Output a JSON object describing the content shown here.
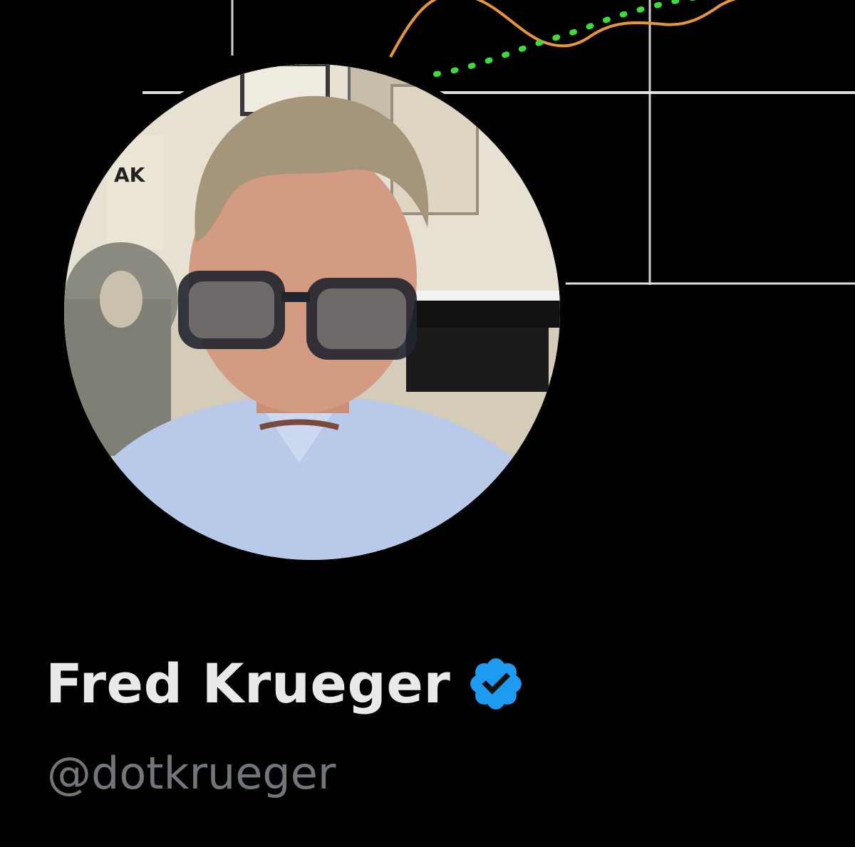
{
  "profile": {
    "display_name": "Fred Krueger",
    "handle": "@dotkrueger",
    "verified": true,
    "verified_icon": "verified-badge-icon"
  },
  "colors": {
    "background": "#000000",
    "name_text": "#e7e9ea",
    "handle_text": "#71767b",
    "verified_blue": "#1d9bf0",
    "banner_orange_line": "#e8963a",
    "banner_green_dots": "#3ddc3d",
    "banner_grid": "#d9d9d9"
  }
}
